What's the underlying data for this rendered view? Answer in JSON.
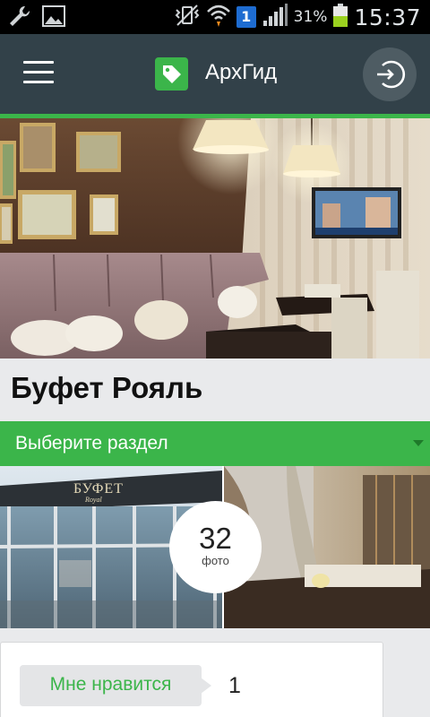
{
  "status_bar": {
    "time": "15:37",
    "battery_percent": "31%",
    "notification_badge": "1",
    "icons": [
      "wrench-icon",
      "image-icon",
      "vibrate-icon",
      "wifi-icon",
      "signal-icon",
      "battery-icon"
    ]
  },
  "app_bar": {
    "title": "АрхГид",
    "menu_icon": "hamburger-icon",
    "logo_icon": "tag-icon",
    "login_icon": "sign-in-icon"
  },
  "venue": {
    "title": "Буфет Рояль"
  },
  "section_select": {
    "label": "Выберите раздел"
  },
  "photos": {
    "count": "32",
    "unit": "фото",
    "storefront_sign": "БУФЕТ",
    "storefront_sign_sub": "Royal"
  },
  "like": {
    "label": "Мне нравится",
    "count": "1"
  },
  "colors": {
    "app_bar": "#324149",
    "accent_green": "#3bb54a",
    "background": "#e9eaec"
  }
}
